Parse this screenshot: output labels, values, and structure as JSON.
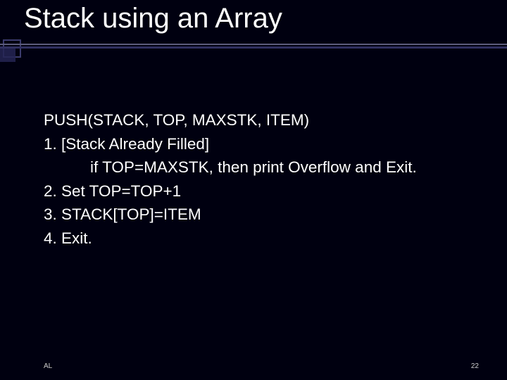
{
  "slide": {
    "title": "Stack using an Array",
    "body": {
      "l0": "PUSH(STACK, TOP, MAXSTK, ITEM)",
      "l1": "1.  [Stack Already Filled]",
      "l2": "if TOP=MAXSTK, then print Overflow and Exit.",
      "l3": "2. Set TOP=TOP+1",
      "l4": "3. STACK[TOP]=ITEM",
      "l5": "4. Exit."
    },
    "footer": {
      "left": "AL",
      "pageNumber": "22"
    }
  }
}
